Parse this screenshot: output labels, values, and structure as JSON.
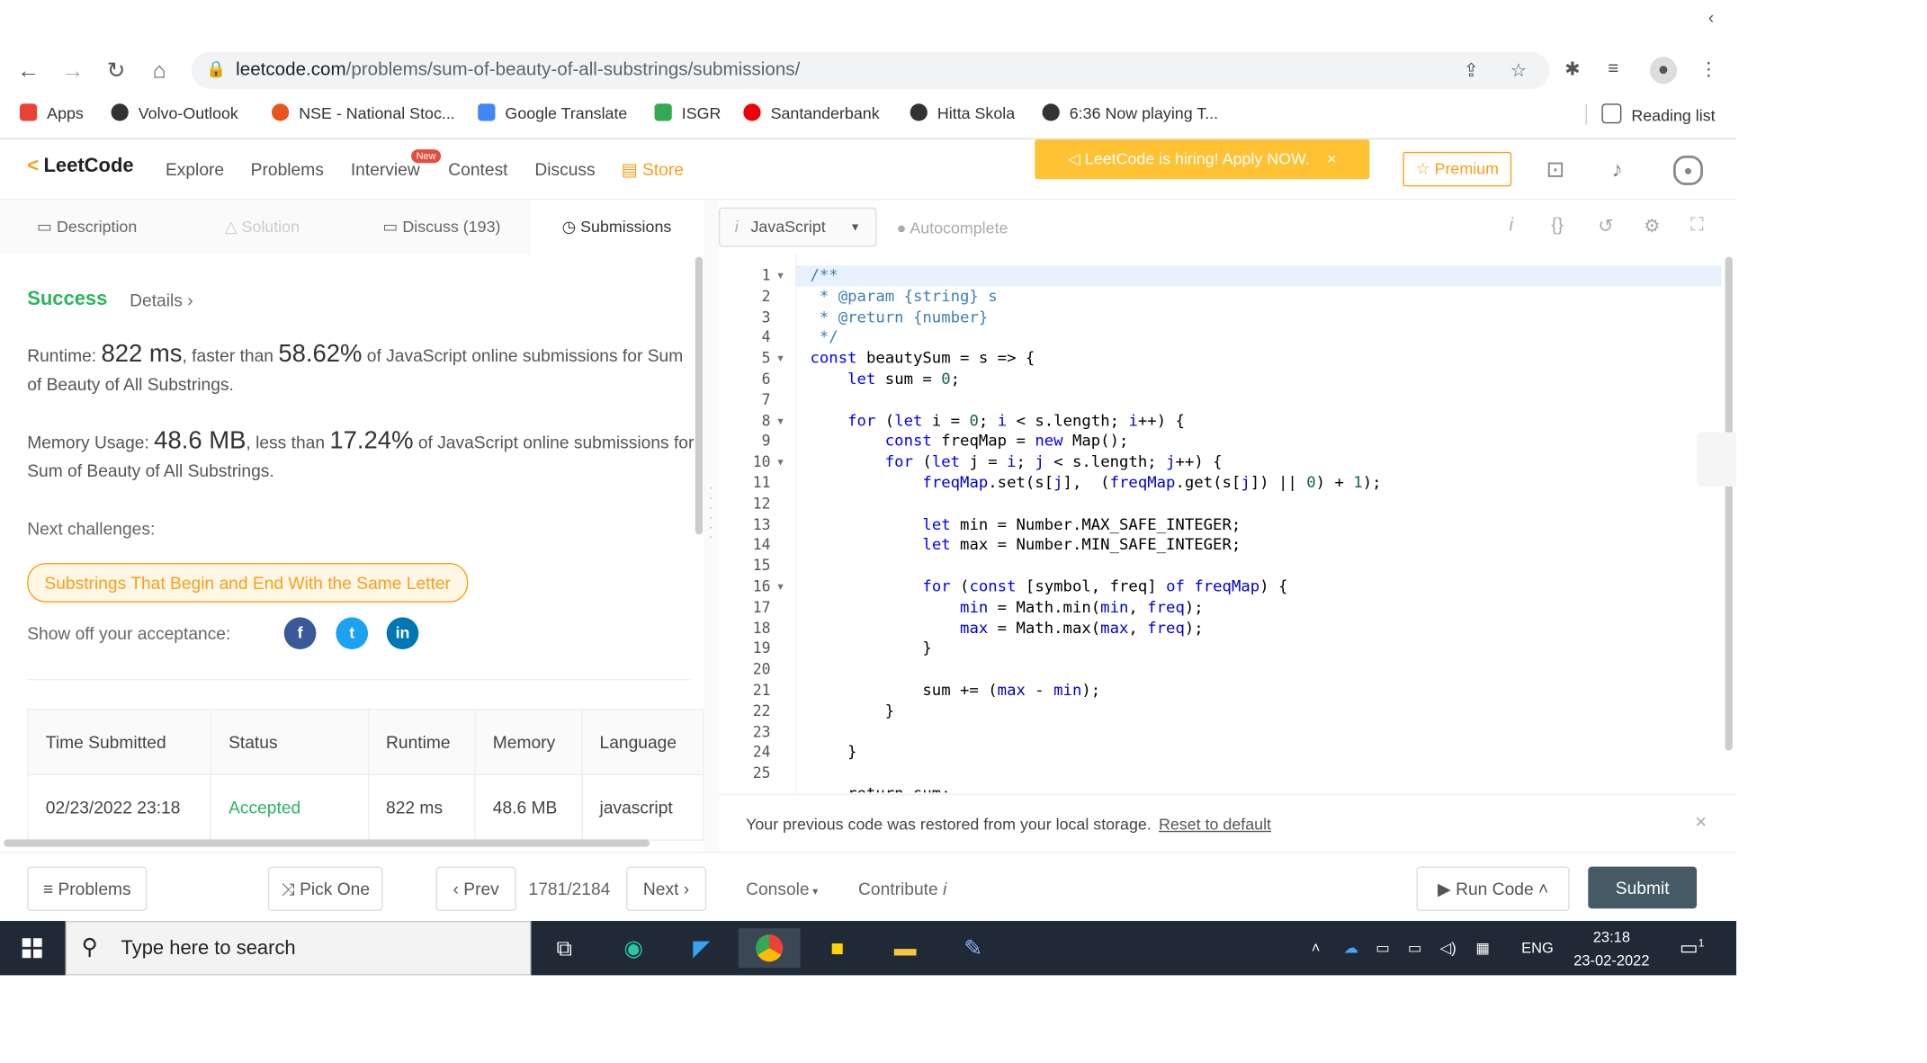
{
  "browser": {
    "url_host": "leetcode.com",
    "url_path": "/problems/sum-of-beauty-of-all-substrings/submissions/",
    "bookmarks": [
      {
        "label": "Apps",
        "color": "#ea4335"
      },
      {
        "label": "Volvo-Outlook",
        "color": "#333333"
      },
      {
        "label": "NSE - National Stoc...",
        "color": "#e8541d"
      },
      {
        "label": "Google Translate",
        "color": "#4285f4"
      },
      {
        "label": "ISGR",
        "color": "#34a853"
      },
      {
        "label": "Santanderbank",
        "color": "#ec0000"
      },
      {
        "label": "Hitta Skola",
        "color": "#333333"
      },
      {
        "label": "6:36 Now playing T...",
        "color": "#333333"
      }
    ],
    "reading_list": "Reading list"
  },
  "nav": {
    "logo": "LeetCode",
    "links": [
      "Explore",
      "Problems",
      "Interview",
      "Contest",
      "Discuss"
    ],
    "new_badge": "New",
    "store": "Store",
    "hiring": "LeetCode is hiring! Apply NOW.",
    "premium": "Premium"
  },
  "tabs": {
    "description": "Description",
    "solution": "Solution",
    "discuss": "Discuss (193)",
    "submissions": "Submissions"
  },
  "result": {
    "status": "Success",
    "details": "Details",
    "runtime_prefix": "Runtime: ",
    "runtime": "822 ms",
    "runtime_mid": ", faster than ",
    "runtime_pct": "58.62%",
    "runtime_suffix": " of JavaScript online submissions for Sum of Beauty of All Substrings.",
    "memory_prefix": "Memory Usage: ",
    "memory": "48.6 MB",
    "memory_mid": ", less than ",
    "memory_pct": "17.24%",
    "memory_suffix": " of JavaScript online submissions for Sum of Beauty of All Substrings.",
    "next_challenges": "Next challenges:",
    "challenge": "Substrings That Begin and End With the Same Letter",
    "show_off": "Show off your acceptance:"
  },
  "table": {
    "headers": [
      "Time Submitted",
      "Status",
      "Runtime",
      "Memory",
      "Language"
    ],
    "row": [
      "02/23/2022 23:18",
      "Accepted",
      "822 ms",
      "48.6 MB",
      "javascript"
    ]
  },
  "editor": {
    "language": "JavaScript",
    "autocomplete": "Autocomplete",
    "restore_msg": "Your previous code was restored from your local storage.",
    "reset": "Reset to default"
  },
  "bottom": {
    "problems": "Problems",
    "pick_one": "Pick One",
    "prev": "Prev",
    "counter": "1781/2184",
    "next": "Next",
    "console": "Console",
    "contribute": "Contribute",
    "run_code": "Run Code",
    "submit": "Submit"
  },
  "taskbar": {
    "search_placeholder": "Type here to search",
    "lang": "ENG",
    "time": "23:18",
    "date": "23-02-2022",
    "notif_count": "1"
  }
}
